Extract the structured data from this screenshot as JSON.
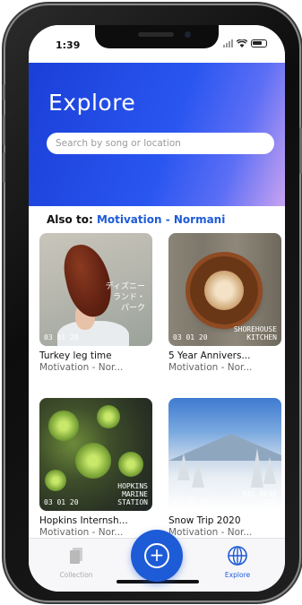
{
  "status": {
    "time": "1:39"
  },
  "header": {
    "title": "Explore"
  },
  "search": {
    "placeholder": "Search by song or location"
  },
  "also": {
    "prefix": "Also to:",
    "link": "Motivation - Normani"
  },
  "cards": [
    {
      "title": "Turkey leg time",
      "subtitle": "Motivation - Nor...",
      "date": "03 01 20",
      "place": "",
      "overlay_text": "ディズニー\nランド・\nパーク"
    },
    {
      "title": "5 Year Annivers...",
      "subtitle": "Motivation - Nor...",
      "date": "03 01 20",
      "place": "SHOREHOUSE\nKITCHEN"
    },
    {
      "title": "Hopkins Internsh...",
      "subtitle": "Motivation - Nor...",
      "date": "03 01 20",
      "place": "HOPKINS\nMARINE\nSTATION"
    },
    {
      "title": "Snow Trip 2020",
      "subtitle": "Motivation - Nor...",
      "date": "02 29 20",
      "place": "BIG BEAR\nLAKE"
    }
  ],
  "tabbar": {
    "collection_label": "Collection",
    "explore_label": "Explore",
    "add_symbol": "+"
  },
  "colors": {
    "accent": "#1e5bd6",
    "header_start": "#1a3fd8",
    "header_end": "#c9a3f0"
  }
}
